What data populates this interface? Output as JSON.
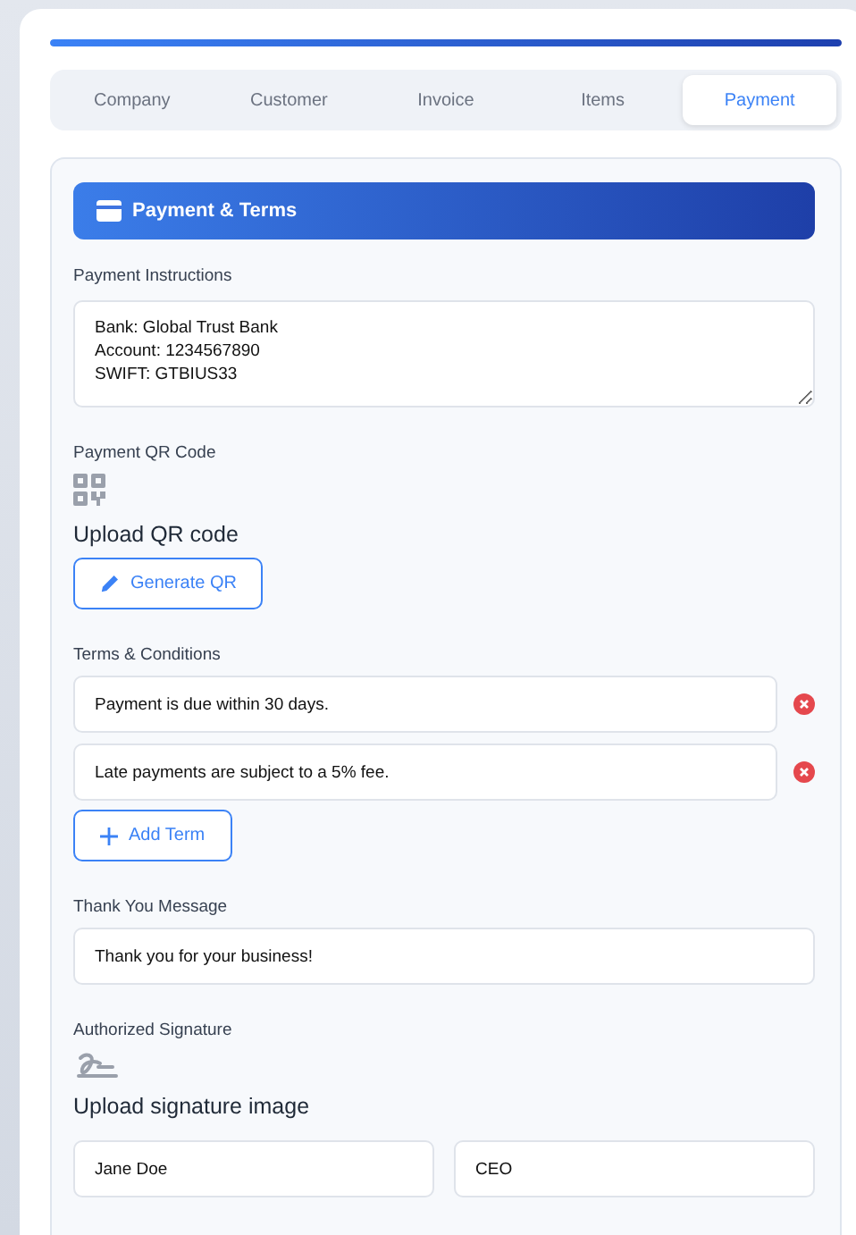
{
  "progress": {
    "level": 1
  },
  "tabs": [
    {
      "label": "Company",
      "selected": false
    },
    {
      "label": "Customer",
      "selected": false
    },
    {
      "label": "Invoice",
      "selected": false
    },
    {
      "label": "Items",
      "selected": false
    },
    {
      "label": "Payment",
      "selected": true
    }
  ],
  "section": {
    "title": "Payment & Terms",
    "payment_instructions": {
      "label": "Payment Instructions",
      "value": "Bank: Global Trust Bank\nAccount: 1234567890\nSWIFT: GTBIUS33"
    },
    "qr": {
      "label": "Payment QR Code",
      "upload_text": "Upload QR code",
      "button": "Generate QR"
    },
    "terms": {
      "label": "Terms & Conditions",
      "items": [
        {
          "value": "Payment is due within 30 days."
        },
        {
          "value": "Late payments are subject to a 5% fee."
        }
      ],
      "add_button": "Add Term"
    },
    "thank_you": {
      "label": "Thank You Message",
      "value": "Thank you for your business!"
    },
    "signature": {
      "label": "Authorized Signature",
      "upload_text": "Upload signature image",
      "name": "Jane Doe",
      "title": "CEO"
    }
  }
}
